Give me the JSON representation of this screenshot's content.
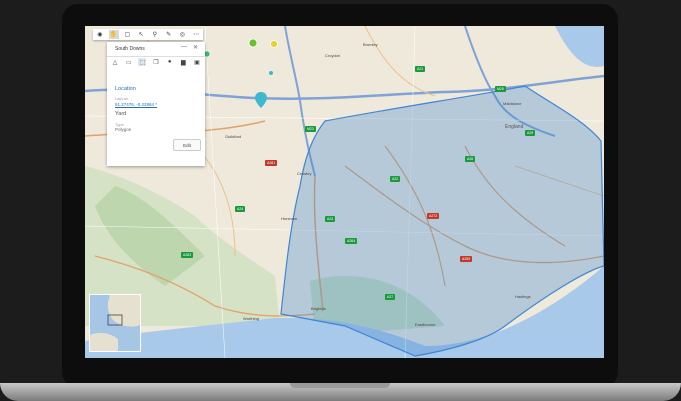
{
  "panel": {
    "title": "South Downs",
    "section_title": "Location",
    "latlon_label": "Lat/Lon",
    "coordinates": "51.27476, -0.22864 *",
    "name_value": "Yard",
    "type_label": "Type",
    "type_value": "Polygon",
    "edit_label": "Edit",
    "minimize_glyph": "—",
    "close_glyph": "✕",
    "tabs": [
      "triangle-ruler-icon",
      "image-icon",
      "shape-icon",
      "layers-icon",
      "circle-icon",
      "folder-icon",
      "camera-icon"
    ]
  },
  "toolbar": {
    "tools": [
      "eye-icon",
      "hand-icon",
      "square-icon",
      "pointer-icon",
      "pin-icon",
      "comment-icon",
      "target-icon",
      "more-icon"
    ]
  },
  "map": {
    "region_label": "England",
    "towns": [
      "Bromley",
      "Croydon",
      "Maidstone",
      "Crawley",
      "Brighton",
      "Worthing",
      "Eastbourne",
      "Hastings",
      "Guildford",
      "Horsham"
    ],
    "roads": [
      "A21",
      "A22",
      "A23",
      "A24",
      "A26",
      "A27",
      "A259",
      "A264",
      "A272",
      "A281",
      "A283",
      "A29",
      "M23",
      "M25"
    ],
    "polygon_color": "#3f86d1",
    "sea_color": "#a9c9ea",
    "land_color": "#efe9dc"
  }
}
